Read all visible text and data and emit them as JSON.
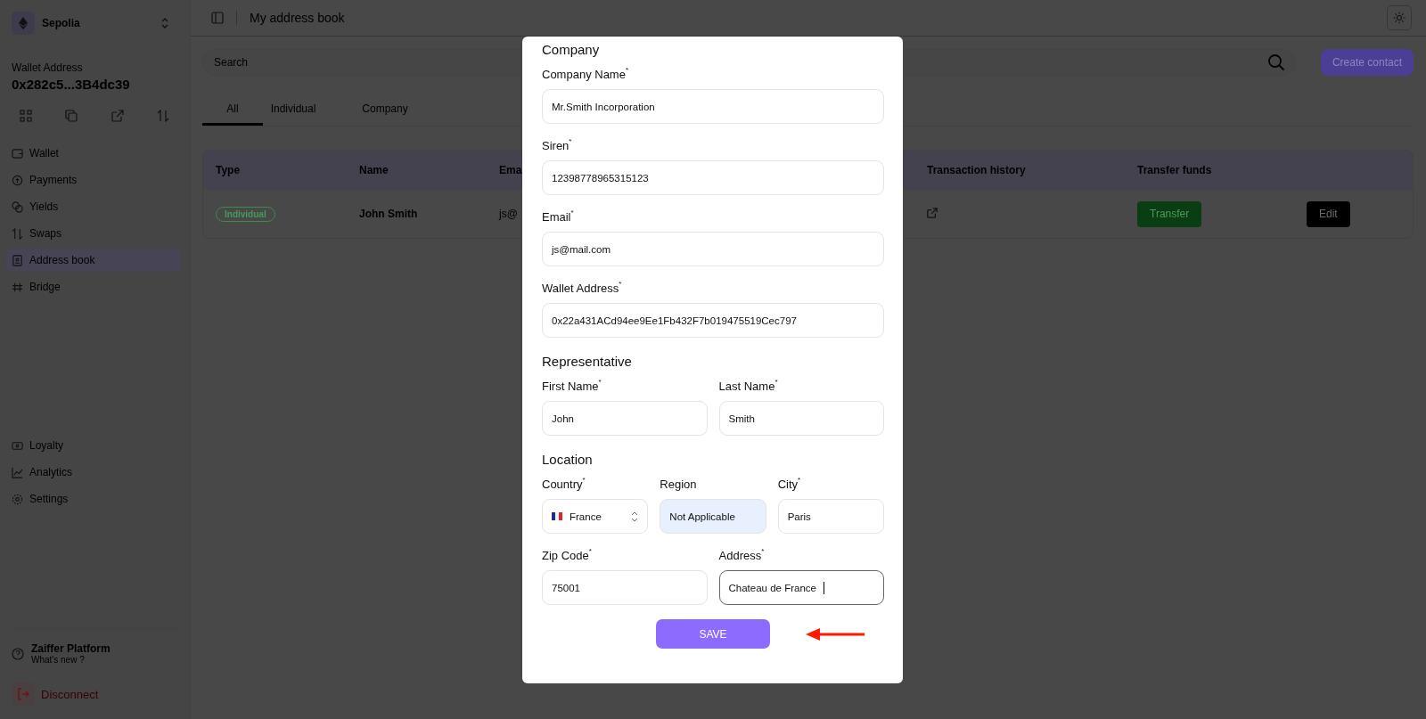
{
  "sidebar": {
    "network": "Sepolia",
    "wallet_label": "Wallet Address",
    "wallet_address": "0x282c5...3B4dc39",
    "nav_items": [
      {
        "label": "Wallet",
        "selected": false
      },
      {
        "label": "Payments",
        "selected": false
      },
      {
        "label": "Yields",
        "selected": false
      },
      {
        "label": "Swaps",
        "selected": false
      },
      {
        "label": "Address book",
        "selected": true
      },
      {
        "label": "Bridge",
        "selected": false
      }
    ],
    "bottom_items": [
      {
        "label": "Loyalty",
        "selected": false
      },
      {
        "label": "Analytics",
        "selected": false
      },
      {
        "label": "Settings",
        "selected": false
      }
    ],
    "platform": {
      "title": "Zaiffer Platform",
      "subtitle": "What's new ?"
    },
    "disconnect": "Disconnect"
  },
  "header": {
    "title": "My address book"
  },
  "search": {
    "placeholder": "Search"
  },
  "create_button": "Create contact",
  "tabs": [
    {
      "label": "All",
      "selected": true
    },
    {
      "label": "Individual",
      "selected": false
    },
    {
      "label": "Company",
      "selected": false
    }
  ],
  "table": {
    "columns": [
      "Type",
      "Name",
      "Ema",
      "Transaction history",
      "Transfer funds"
    ],
    "rows": [
      {
        "type": "Individual",
        "name": "John Smith",
        "email": "js@",
        "transfer": "Transfer",
        "edit": "Edit"
      }
    ]
  },
  "modal": {
    "sections": [
      {
        "title": "Company",
        "rows": [
          [
            {
              "label": "Company Name$^{*}$",
              "value": "Mr.Smith Incorporation",
              "kind": "text"
            }
          ],
          [
            {
              "label": "Siren$^{*}$",
              "value": "12398778965315123",
              "kind": "text"
            }
          ],
          [
            {
              "label": "Email$^{*}$",
              "value": "js@mail.com",
              "kind": "text"
            }
          ],
          [
            {
              "label": "Wallet Address$^{*}$",
              "value": "0x22a431ACd94ee9Ee1Fb432F7b019475519Cec797",
              "kind": "text"
            }
          ]
        ]
      },
      {
        "title": "Representative",
        "rows": [
          [
            {
              "label": "First Name$^{*}$",
              "value": "John",
              "kind": "text"
            },
            {
              "label": "Last Name$^{*}$",
              "value": "Smith",
              "kind": "text"
            }
          ]
        ]
      },
      {
        "title": "Location",
        "rows": [
          [
            {
              "label": "Country$^{*}$",
              "value": "France",
              "kind": "select"
            },
            {
              "label": "Region",
              "value": "Not Applicable",
              "kind": "readonly"
            },
            {
              "label": "City$^{*}$",
              "value": "Paris",
              "kind": "text"
            }
          ],
          [
            {
              "label": "Zip Code$^{*}$",
              "value": "75001",
              "kind": "text"
            },
            {
              "label": "Address$^{*}$",
              "value": "Chateau de France",
              "kind": "text",
              "focused": true
            }
          ]
        ]
      }
    ],
    "save_button": "SAVE"
  }
}
